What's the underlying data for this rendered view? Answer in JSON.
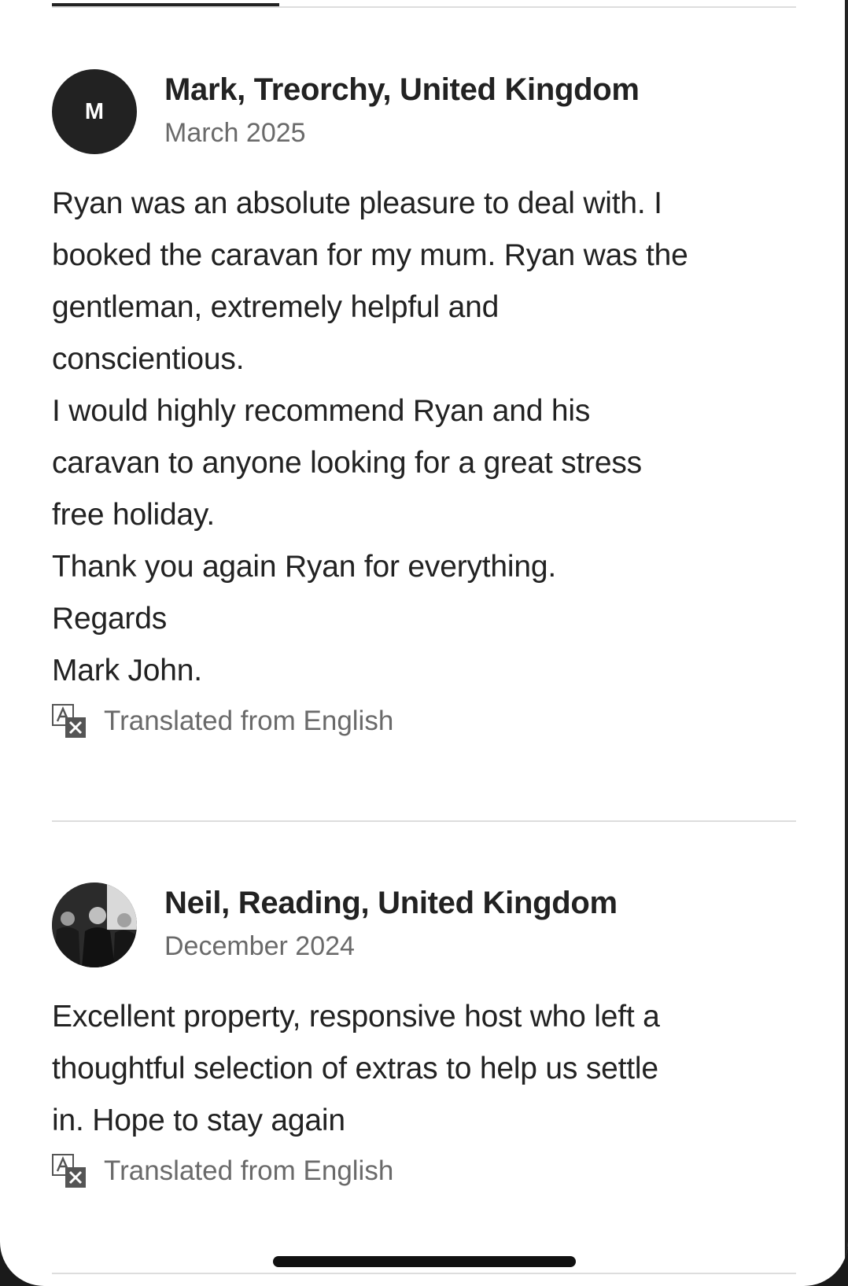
{
  "reviews": [
    {
      "avatar_initial": "M",
      "avatar_type": "initial",
      "reviewer": "Mark, Treorchy, United Kingdom",
      "date": "March 2025",
      "text": "Ryan was an absolute pleasure to deal with. I\nbooked the caravan for my mum. Ryan was the\ngentleman, extremely helpful and\nconscientious.\nI would highly recommend Ryan and his\ncaravan to anyone looking for a great stress\nfree holiday.\nThank you again Ryan for everything.\nRegards\nMark John.",
      "translation_note": "Translated from English"
    },
    {
      "avatar_initial": "",
      "avatar_type": "photo",
      "reviewer": "Neil, Reading, United Kingdom",
      "date": "December 2024",
      "text": "Excellent property, responsive host who left a\nthoughtful selection of extras to help us settle\nin. Hope to stay again",
      "translation_note": "Translated from English"
    }
  ],
  "icons": {
    "translate": "translate-icon"
  },
  "colors": {
    "text_primary": "#222222",
    "text_secondary": "#6a6a6a",
    "divider": "#dddddd",
    "avatar_bg": "#222222"
  }
}
